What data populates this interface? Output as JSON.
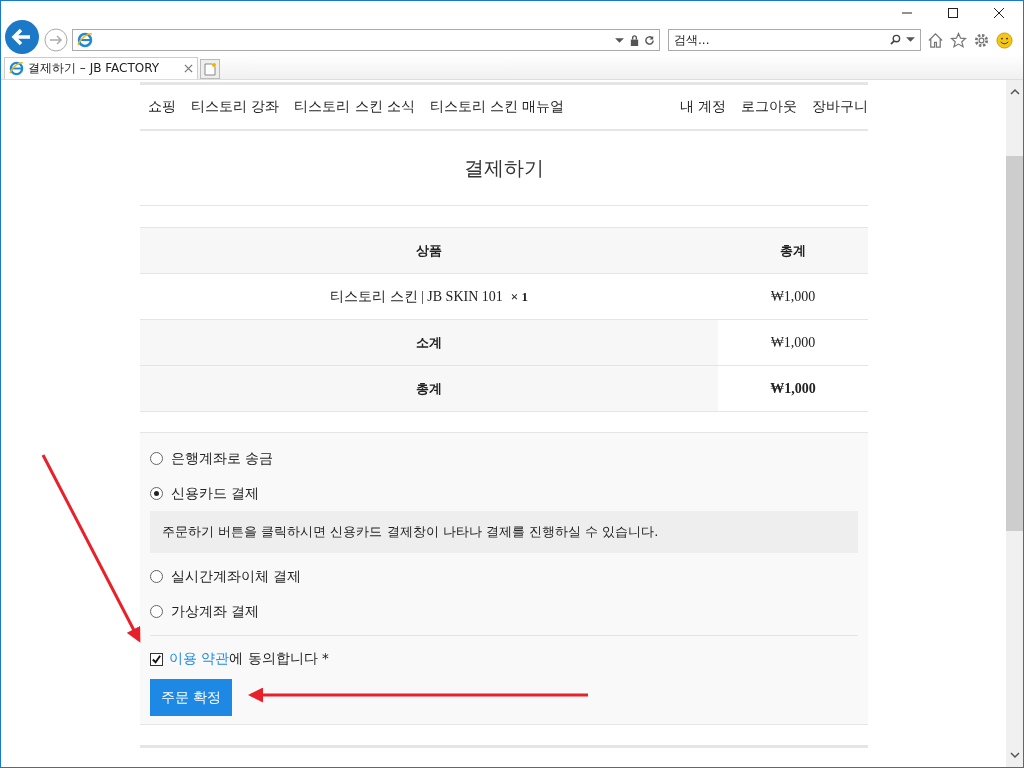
{
  "browser": {
    "search_placeholder": "검색...",
    "tabs": [
      {
        "label": "결제하기 – JB FACTORY",
        "selected": true
      }
    ]
  },
  "nav": {
    "left": [
      "쇼핑",
      "티스토리 강좌",
      "티스토리 스킨 소식",
      "티스토리 스킨 매뉴얼"
    ],
    "right": [
      "내 계정",
      "로그아웃",
      "장바구니"
    ]
  },
  "page_title": "결제하기",
  "order_table": {
    "columns": [
      "상품",
      "총계"
    ],
    "rows": [
      {
        "kind": "item",
        "label": "티스토리 스킨 | JB SKIN 101",
        "quantity": "× 1",
        "value": "₩1,000"
      },
      {
        "kind": "summary",
        "label": "소계",
        "value": "₩1,000"
      },
      {
        "kind": "total",
        "label": "총계",
        "value": "₩1,000"
      }
    ]
  },
  "payment_methods": [
    {
      "label": "은행계좌로 송금",
      "selected": false
    },
    {
      "label": "신용카드 결제",
      "selected": true,
      "description": "주문하기 버튼을 클릭하시면 신용카드 결제창이 나타나 결제를 진행하실 수 있습니다."
    },
    {
      "label": "실시간계좌이체 결제",
      "selected": false
    },
    {
      "label": "가상계좌 결제",
      "selected": false
    }
  ],
  "terms": {
    "checked": true,
    "link": "이용 약관",
    "text": "에 동의합니다 *"
  },
  "submit_button": "주문 확정"
}
